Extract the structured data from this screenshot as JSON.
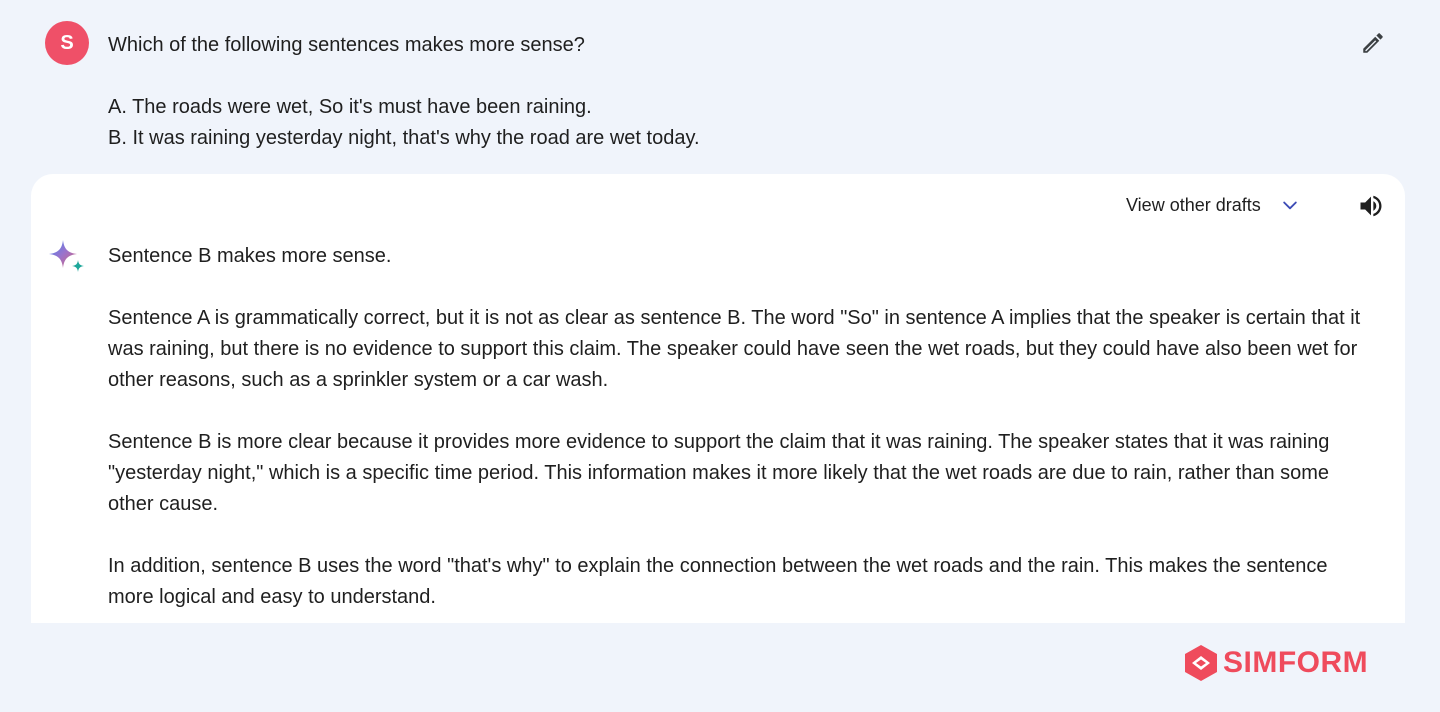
{
  "user": {
    "avatar_letter": "S",
    "avatar_color": "#ef5068"
  },
  "prompt": {
    "question": "Which of the following sentences makes more sense?",
    "option_a": "A. The roads were wet, So it's must have been raining.",
    "option_b": "B. It was raining yesterday night, that's why the road are wet today."
  },
  "response_header": {
    "drafts_label": "View other drafts",
    "drafts_icon": "chevron-down-icon",
    "speaker_icon": "speaker-icon",
    "edit_icon": "pencil-icon",
    "assistant_icon": "sparkle-icon"
  },
  "response": {
    "paragraphs": [
      "Sentence B makes more sense.",
      "Sentence A is grammatically correct, but it is not as clear as sentence B. The word \"So\" in sentence A implies that the speaker is certain that it was raining, but there is no evidence to support this claim. The speaker could have seen the wet roads, but they could have also been wet for other reasons, such as a sprinkler system or a car wash.",
      "Sentence B is more clear because it provides more evidence to support the claim that it was raining. The speaker states that it was raining \"yesterday night,\" which is a specific time period. This information makes it more likely that the wet roads are due to rain, rather than some other cause.",
      "In addition, sentence B uses the word \"that's why\" to explain the connection between the wet roads and the rain. This makes the sentence more logical and easy to understand."
    ]
  },
  "branding": {
    "logo_text": "SIMFORM",
    "logo_color": "#ef4b5c"
  },
  "colors": {
    "page_background": "#f0f4fb",
    "card_background": "#ffffff",
    "chevron_accent": "#3c4bb5"
  }
}
